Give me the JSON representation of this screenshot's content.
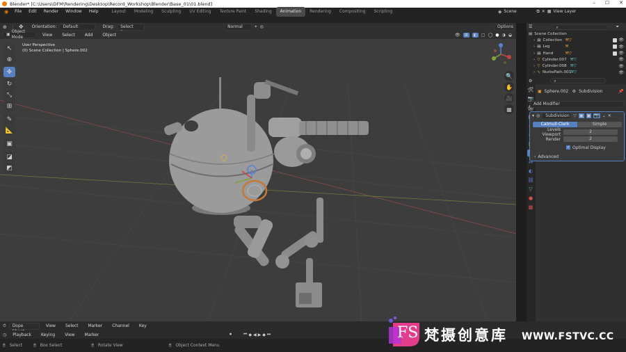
{
  "window": {
    "title": "Blender* [C:\\Users\\DFM\\Rendering\\Desktop\\Record_Workshop\\Blender\\Base_01\\01.blend]"
  },
  "menu": [
    "File",
    "Edit",
    "Render",
    "Window",
    "Help"
  ],
  "workspaces": [
    "Layout",
    "Modeling",
    "Sculpting",
    "UV Editing",
    "Texture Paint",
    "Shading",
    "Animation",
    "Rendering",
    "Compositing",
    "Scripting"
  ],
  "active_workspace": "Animation",
  "scene": {
    "name": "Scene",
    "view_layer": "View Layer"
  },
  "tool_header": {
    "orientation_label": "Orientation:",
    "orientation_value": "Default",
    "drag_label": "Drag:",
    "drag_value": "Select Box",
    "pivot": "Normal",
    "options": "Options"
  },
  "viewport_header": {
    "mode": "Object Mode",
    "menus": [
      "View",
      "Select",
      "Add",
      "Object"
    ]
  },
  "viewport": {
    "perspective": "User Perspective",
    "context": "(0) Scene Collection | Sphere.002"
  },
  "outliner": {
    "root": "Scene Collection",
    "items": [
      "Collection",
      "Leg",
      "Hand",
      "Cylinder.007",
      "Cylinder.008",
      "NurbsPath.001"
    ]
  },
  "properties": {
    "object_name": "Sphere.002",
    "modifier_breadcrumb": "Subdivision",
    "add_modifier": "Add Modifier",
    "modifier_name": "Subdivision",
    "tabs": [
      "Catmull-Clark",
      "Simple"
    ],
    "active_tab": "Catmull-Clark",
    "levels_viewport_label": "Levels Viewport",
    "levels_viewport_value": "2",
    "render_label": "Render",
    "render_value": "2",
    "optimal_display": "Optimal Display",
    "advanced": "Advanced"
  },
  "dopesheet": {
    "editor": "Dope Sheet",
    "menus": [
      "View",
      "Select",
      "Marker",
      "Channel",
      "Key"
    ]
  },
  "timeline": {
    "menus": [
      "Playback",
      "Keying",
      "View",
      "Marker"
    ]
  },
  "statusbar": {
    "select": "Select",
    "box_select": "Box Select",
    "rotate_view": "Rotate View",
    "context_menu": "Object Context Menu"
  },
  "watermark": {
    "text": "梵摄创意库",
    "url": "WWW.FSTVC.CC",
    "logo": "FS"
  },
  "colors": {
    "accent": "#5680c2",
    "orange": "#e87d0d",
    "viewport_bg": "#3d3d3d"
  },
  "icons": [
    "blender-logo-icon",
    "cursor-icon",
    "move-icon",
    "rotate-icon",
    "scale-icon",
    "transform-icon",
    "annotate-icon",
    "measure-icon",
    "add-cube-icon",
    "eye-icon",
    "wrench-icon",
    "play-icon"
  ]
}
